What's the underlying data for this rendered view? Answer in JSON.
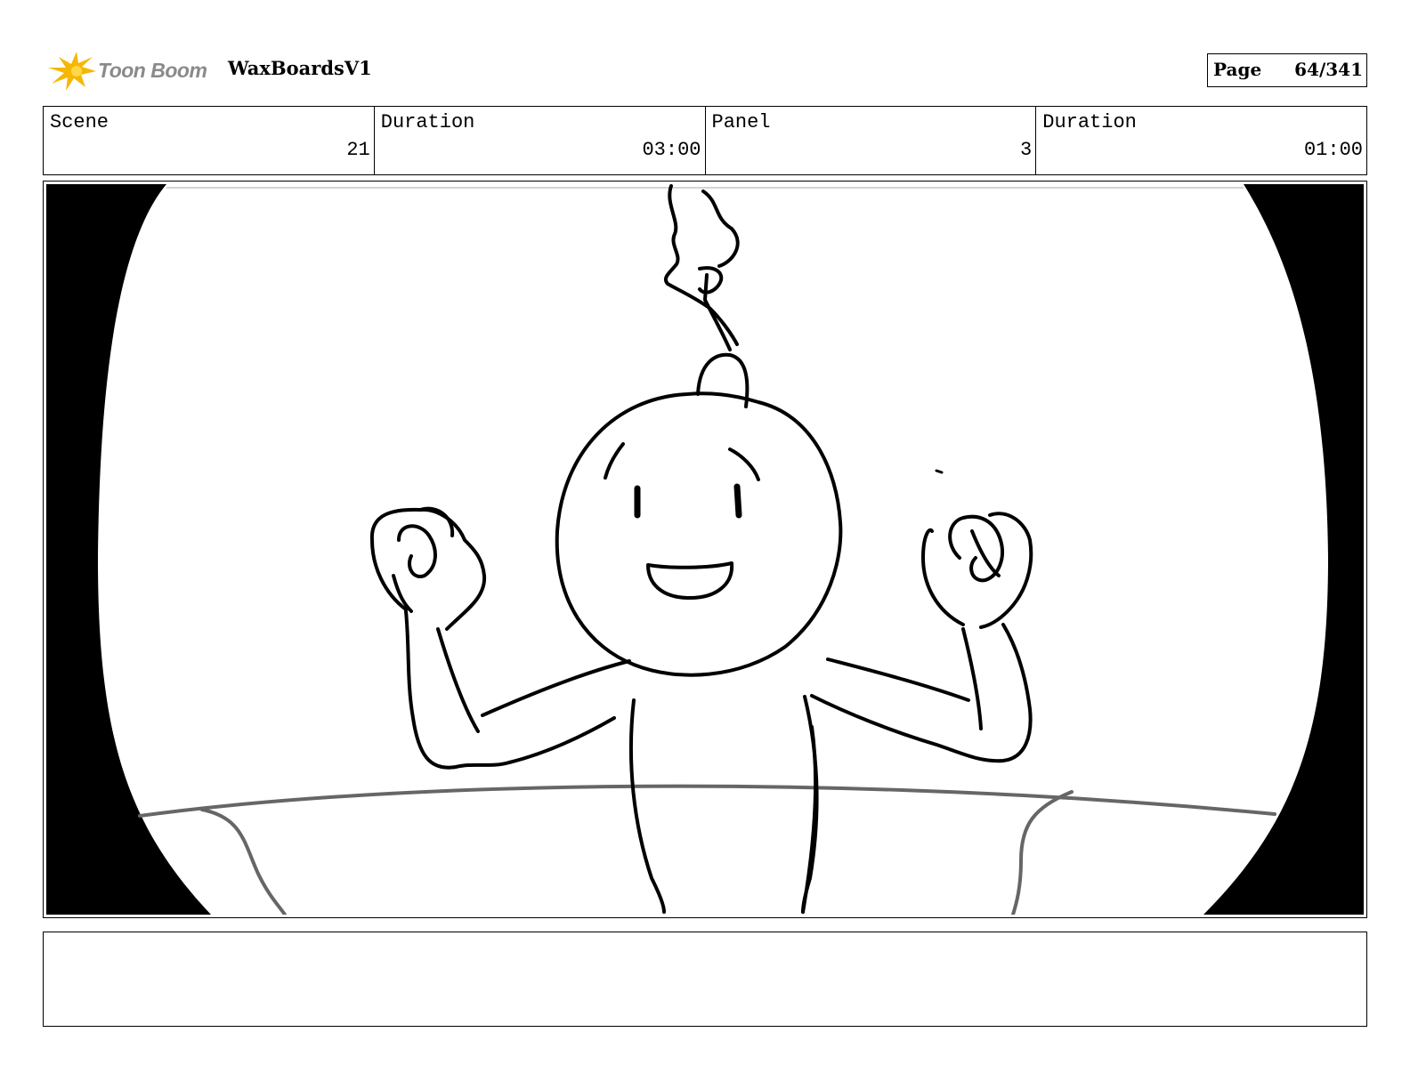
{
  "header": {
    "brand": "Toon Boom",
    "project_title": "WaxBoardsV1",
    "page_label": "Page",
    "page_number": "64/341"
  },
  "info": {
    "scene_label": "Scene",
    "scene_value": "21",
    "scene_duration_label": "Duration",
    "scene_duration_value": "03:00",
    "panel_label": "Panel",
    "panel_value": "3",
    "panel_duration_label": "Duration",
    "panel_duration_value": "01:00"
  },
  "notes": "",
  "colors": {
    "logo_orange": "#F5B700",
    "logo_text": "#8a8a8a",
    "sketch_line": "#000000",
    "ground_line": "#666666"
  }
}
